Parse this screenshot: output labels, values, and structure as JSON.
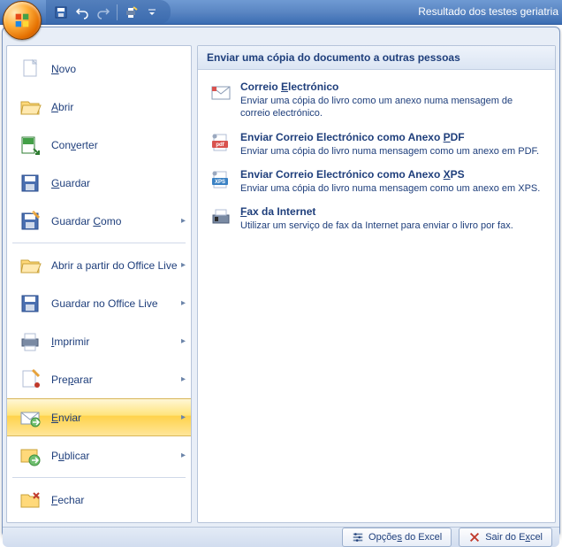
{
  "title": "Resultado dos testes geriatria",
  "qat": {
    "save_icon": "save-icon",
    "undo_icon": "undo-icon",
    "redo_icon": "redo-icon",
    "quickprint_icon": "quickprint-icon",
    "customize_icon": "customize-qat-icon"
  },
  "left_menu": [
    {
      "label": "Novo",
      "accel_index": 0,
      "icon": "new",
      "has_sub": false
    },
    {
      "label": "Abrir",
      "accel_index": 0,
      "icon": "open",
      "has_sub": false
    },
    {
      "label": "Converter",
      "accel_index": 3,
      "icon": "convert",
      "has_sub": false
    },
    {
      "label": "Guardar",
      "accel_index": 0,
      "icon": "save",
      "has_sub": false
    },
    {
      "label": "Guardar Como",
      "accel_index": 8,
      "icon": "saveas",
      "has_sub": true
    },
    {
      "label": "Abrir a partir do Office Live",
      "accel_index": -1,
      "icon": "openlive",
      "has_sub": true
    },
    {
      "label": "Guardar no Office Live",
      "accel_index": -1,
      "icon": "savelive",
      "has_sub": true
    },
    {
      "label": "Imprimir",
      "accel_index": 0,
      "icon": "print",
      "has_sub": true
    },
    {
      "label": "Preparar",
      "accel_index": 3,
      "icon": "prepare",
      "has_sub": true
    },
    {
      "label": "Enviar",
      "accel_index": 0,
      "icon": "send",
      "has_sub": true,
      "selected": true
    },
    {
      "label": "Publicar",
      "accel_index": 1,
      "icon": "publish",
      "has_sub": true
    },
    {
      "label": "Fechar",
      "accel_index": 0,
      "icon": "close",
      "has_sub": false
    }
  ],
  "right_panel": {
    "header": "Enviar uma cópia do documento a outras pessoas",
    "items": [
      {
        "title": "Correio Electrónico",
        "title_accel": "Correio <u>E</u>lectrónico",
        "desc": "Enviar uma cópia do livro como um anexo numa mensagem de correio electrónico.",
        "icon": "email"
      },
      {
        "title": "Enviar Correio Electrónico como Anexo PDF",
        "title_accel": "Enviar Correio Electrónico como Anexo <u>P</u>DF",
        "desc": "Enviar uma cópia do livro numa mensagem como um anexo em PDF.",
        "icon": "pdf"
      },
      {
        "title": "Enviar Correio Electrónico como Anexo XPS",
        "title_accel": "Enviar Correio Electrónico como Anexo <u>X</u>PS",
        "desc": "Enviar uma cópia do livro numa mensagem como um anexo em XPS.",
        "icon": "xps"
      },
      {
        "title": "Fax da Internet",
        "title_accel": "<u>F</u>ax da Internet",
        "desc": "Utilizar um serviço de fax da Internet para enviar o livro por fax.",
        "icon": "fax"
      }
    ]
  },
  "footer": {
    "options_label": "Opções do Excel",
    "options_accel": "Opçõe<u>s</u> do Excel",
    "exit_label": "Sair do Excel",
    "exit_accel": "Sair do E<u>x</u>cel"
  }
}
